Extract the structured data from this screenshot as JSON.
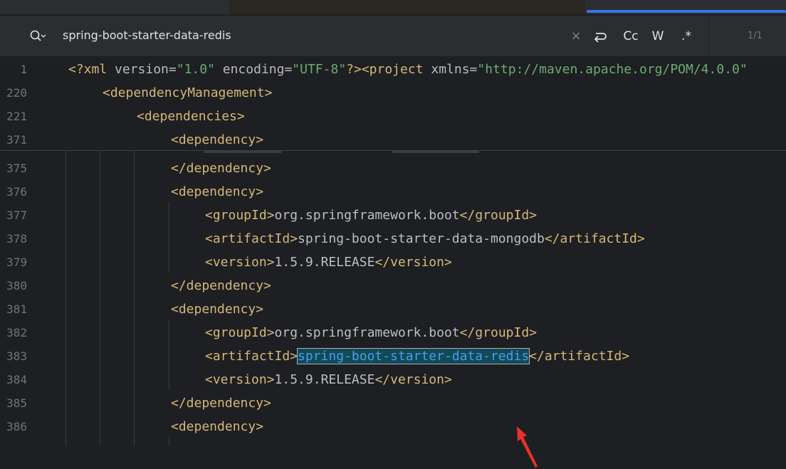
{
  "search": {
    "query": "spring-boot-starter-data-redis",
    "case_label": "Cc",
    "word_label": "W",
    "regex_label": ".*",
    "close_glyph": "×",
    "match_count": "1/1"
  },
  "sticky_lines": [
    {
      "num": "1",
      "tag1": "<?xml ",
      "a1": "version=",
      "s1": "\"1.0\"",
      "a2": " encoding=",
      "s2": "\"UTF-8\"",
      "tag2": "?><project ",
      "a3": "xmlns=",
      "s3": "\"http://maven.apache.org/POM/4.0.0\""
    },
    {
      "num": "220",
      "tag": "<dependencyManagement>"
    },
    {
      "num": "221",
      "tag": "<dependencies>"
    },
    {
      "num": "371",
      "tag": "<dependency>"
    }
  ],
  "lines": [
    {
      "num": "375",
      "parts": [
        {
          "t": "tag",
          "v": "</dependency>"
        }
      ]
    },
    {
      "num": "376",
      "parts": [
        {
          "t": "tag",
          "v": "<dependency>"
        }
      ]
    },
    {
      "num": "377",
      "parts": [
        {
          "t": "tag",
          "v": "<groupId>"
        },
        {
          "t": "txt",
          "v": "org.springframework.boot"
        },
        {
          "t": "tag",
          "v": "</groupId>"
        }
      ]
    },
    {
      "num": "378",
      "parts": [
        {
          "t": "tag",
          "v": "<artifactId>"
        },
        {
          "t": "txt",
          "v": "spring-boot-starter-data-mongodb"
        },
        {
          "t": "tag",
          "v": "</artifactId>"
        }
      ]
    },
    {
      "num": "379",
      "parts": [
        {
          "t": "tag",
          "v": "<version>"
        },
        {
          "t": "txt",
          "v": "1.5.9.RELEASE"
        },
        {
          "t": "tag",
          "v": "</version>"
        }
      ]
    },
    {
      "num": "380",
      "parts": [
        {
          "t": "tag",
          "v": "</dependency>"
        }
      ]
    },
    {
      "num": "381",
      "parts": [
        {
          "t": "tag",
          "v": "<dependency>"
        }
      ]
    },
    {
      "num": "382",
      "parts": [
        {
          "t": "tag",
          "v": "<groupId>"
        },
        {
          "t": "txt",
          "v": "org.springframework.boot"
        },
        {
          "t": "tag",
          "v": "</groupId>"
        }
      ]
    },
    {
      "num": "383",
      "parts": [
        {
          "t": "tag",
          "v": "<artifactId>"
        },
        {
          "t": "hl",
          "v": "spring-boot-starter-data-redis"
        },
        {
          "t": "tag",
          "v": "</artifactId>"
        }
      ]
    },
    {
      "num": "384",
      "parts": [
        {
          "t": "tag",
          "v": "<version>"
        },
        {
          "t": "txt",
          "v": "1.5.9.RELEASE"
        },
        {
          "t": "tag",
          "v": "</version>"
        }
      ]
    },
    {
      "num": "385",
      "parts": [
        {
          "t": "tag",
          "v": "</dependency>"
        }
      ]
    },
    {
      "num": "386",
      "parts": [
        {
          "t": "tag",
          "v": "<dependency>"
        }
      ]
    }
  ],
  "colors": {
    "tag": "#d5b778",
    "string": "#6aab73",
    "text": "#bcbec4",
    "match_highlight": "#114957",
    "accent": "#3574f0",
    "arrow": "#e8322c"
  },
  "icons": [
    "search-icon",
    "close-icon",
    "wrap-icon",
    "arrow-annotation-icon"
  ]
}
